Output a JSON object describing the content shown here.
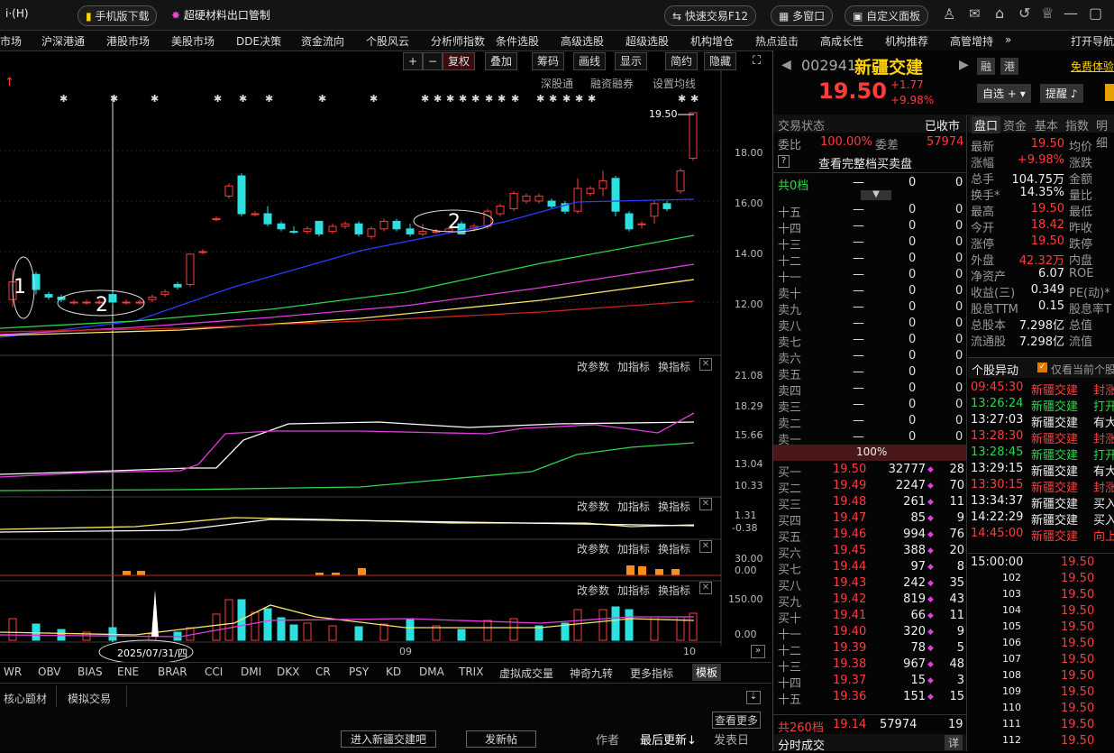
{
  "topbar": {
    "app_logo": "i·(H)",
    "mobile_btn": "手机版下载",
    "news_btn": "超硬材料出口管制",
    "quick_trade": "快速交易F12",
    "multi_window": "多窗口",
    "custom_panel": "自定义面板"
  },
  "menu": [
    "市场",
    "沪深港通",
    "港股市场",
    "美股市场",
    "DDE决策",
    "资金流向",
    "个股风云",
    "分析师指数",
    "条件选股",
    "高级选股",
    "超级选股",
    "机构增仓",
    "热点追击",
    "高成长性",
    "机构推荐",
    "高管增持",
    "»",
    "打开导航"
  ],
  "chart_toolbar": {
    "plus": "+",
    "minus": "−",
    "fuquan": "复权",
    "diejia": "叠加",
    "chouma": "筹码",
    "huaxian": "画线",
    "xianshi": "显示",
    "jianyue": "简约",
    "yincang": "隐藏",
    "shengutong": "深股通",
    "rongzi": "融资融券",
    "junxian": "设置均线"
  },
  "price_axis": [
    "18.00",
    "16.00",
    "14.00",
    "12.00"
  ],
  "last_price_label": "19.50",
  "annotations": {
    "one": "1",
    "two_a": "2",
    "two_b": "2"
  },
  "sub1": {
    "axis": [
      "21.08",
      "18.29",
      "15.66",
      "13.04",
      "10.33"
    ]
  },
  "sub2": {
    "axis": [
      "1.31",
      "-0.38"
    ]
  },
  "sub3": {
    "axis": [
      "30.00",
      "0.00"
    ]
  },
  "sub4": {
    "axis": [
      "150.00",
      "0.00"
    ]
  },
  "sub_buttons": {
    "param": "改参数",
    "add": "加指标",
    "switch": "换指标"
  },
  "x_axis": {
    "date_label": "2025/07/31/四",
    "m09": "09",
    "m10": "10"
  },
  "ind_tabs": [
    "WR",
    "OBV",
    "BIAS",
    "ENE",
    "BRAR",
    "CCI",
    "DMI",
    "DKX",
    "CR",
    "PSY",
    "KD",
    "DMA",
    "TRIX",
    "虚拟成交量",
    "神奇九转",
    "更多指标",
    "模板"
  ],
  "footer": {
    "tab1": "核心题材",
    "tab2": "模拟交易",
    "more": "查看更多",
    "enter": "进入新疆交建吧",
    "post": "发新帖",
    "author": "作者",
    "last_update": "最后更新",
    "post_date": "发表日"
  },
  "stock": {
    "code": "002941",
    "name": "新疆交建",
    "price": "19.50",
    "change": "+1.77",
    "pct": "+9.98%",
    "tag_rong": "融",
    "tag_gang": "港",
    "free_trial": "免费体验",
    "zixuan": "自选",
    "tixing": "提醒"
  },
  "orderbook": {
    "status_label": "交易状态",
    "status_value": "已收市",
    "weibi_label": "委比",
    "weibi_value": "100.00%",
    "weicha_label": "委差",
    "weicha_value": "57974",
    "full_link": "查看完整档买卖盘",
    "top_label": "共0档",
    "top_dash": "—",
    "top_v1": "0",
    "top_v2": "0",
    "asks": [
      {
        "label": "十五",
        "price": "—",
        "vol": "0",
        "cnt": "0"
      },
      {
        "label": "十四",
        "price": "—",
        "vol": "0",
        "cnt": "0"
      },
      {
        "label": "十三",
        "price": "—",
        "vol": "0",
        "cnt": "0"
      },
      {
        "label": "十二",
        "price": "—",
        "vol": "0",
        "cnt": "0"
      },
      {
        "label": "十一",
        "price": "—",
        "vol": "0",
        "cnt": "0"
      },
      {
        "label": "卖十",
        "price": "—",
        "vol": "0",
        "cnt": "0"
      },
      {
        "label": "卖九",
        "price": "—",
        "vol": "0",
        "cnt": "0"
      },
      {
        "label": "卖八",
        "price": "—",
        "vol": "0",
        "cnt": "0"
      },
      {
        "label": "卖七",
        "price": "—",
        "vol": "0",
        "cnt": "0"
      },
      {
        "label": "卖六",
        "price": "—",
        "vol": "0",
        "cnt": "0"
      },
      {
        "label": "卖五",
        "price": "—",
        "vol": "0",
        "cnt": "0"
      },
      {
        "label": "卖四",
        "price": "—",
        "vol": "0",
        "cnt": "0"
      },
      {
        "label": "卖三",
        "price": "—",
        "vol": "0",
        "cnt": "0"
      },
      {
        "label": "卖二",
        "price": "—",
        "vol": "0",
        "cnt": "0"
      },
      {
        "label": "卖一",
        "price": "—",
        "vol": "0",
        "cnt": "0"
      }
    ],
    "ratio": "100%",
    "bids": [
      {
        "label": "买一",
        "price": "19.50",
        "vol": "32777",
        "cnt": "28"
      },
      {
        "label": "买二",
        "price": "19.49",
        "vol": "2247",
        "cnt": "70"
      },
      {
        "label": "买三",
        "price": "19.48",
        "vol": "261",
        "cnt": "11"
      },
      {
        "label": "买四",
        "price": "19.47",
        "vol": "85",
        "cnt": "9"
      },
      {
        "label": "买五",
        "price": "19.46",
        "vol": "994",
        "cnt": "76"
      },
      {
        "label": "买六",
        "price": "19.45",
        "vol": "388",
        "cnt": "20"
      },
      {
        "label": "买七",
        "price": "19.44",
        "vol": "97",
        "cnt": "8"
      },
      {
        "label": "买八",
        "price": "19.43",
        "vol": "242",
        "cnt": "35"
      },
      {
        "label": "买九",
        "price": "19.42",
        "vol": "819",
        "cnt": "43"
      },
      {
        "label": "买十",
        "price": "19.41",
        "vol": "66",
        "cnt": "11"
      },
      {
        "label": "十一",
        "price": "19.40",
        "vol": "320",
        "cnt": "9"
      },
      {
        "label": "十二",
        "price": "19.39",
        "vol": "78",
        "cnt": "5"
      },
      {
        "label": "十三",
        "price": "19.38",
        "vol": "967",
        "cnt": "48"
      },
      {
        "label": "十四",
        "price": "19.37",
        "vol": "15",
        "cnt": "3"
      },
      {
        "label": "十五",
        "price": "19.36",
        "vol": "151",
        "cnt": "15"
      }
    ],
    "total_label": "共260档",
    "total_price": "19.14",
    "total_vol": "57974",
    "total_cnt": "19",
    "fenshi": "分时成交",
    "detail": "详"
  },
  "quote_tabs": [
    "盘口",
    "资金",
    "基本",
    "指数",
    "明细"
  ],
  "quote": [
    {
      "l": "最新",
      "v": "19.50",
      "l2": "均价"
    },
    {
      "l": "涨幅",
      "v": "+9.98%",
      "l2": "涨跌"
    },
    {
      "l": "总手",
      "v": "104.75万",
      "l2": "金额"
    },
    {
      "l": "换手*",
      "v": "14.35%",
      "l2": "量比"
    },
    {
      "l": "最高",
      "v": "19.50",
      "l2": "最低"
    },
    {
      "l": "今开",
      "v": "18.42",
      "l2": "昨收"
    },
    {
      "l": "涨停",
      "v": "19.50",
      "l2": "跌停"
    },
    {
      "l": "外盘",
      "v": "42.32万",
      "l2": "内盘"
    },
    {
      "l": "净资产",
      "v": "6.07",
      "l2": "ROE"
    },
    {
      "l": "收益(三)",
      "v": "0.349",
      "l2": "PE(动)*"
    },
    {
      "l": "股息TTM",
      "v": "0.15",
      "l2": "股息率T"
    },
    {
      "l": "总股本",
      "v": "7.298亿",
      "l2": "总值"
    },
    {
      "l": "流通股",
      "v": "7.298亿",
      "l2": "流值"
    }
  ],
  "events_header": {
    "title": "个股异动",
    "only_current": "仅看当前个股"
  },
  "events": [
    {
      "t": "09:45:30",
      "n": "新疆交建",
      "a": "封涨",
      "c": "red"
    },
    {
      "t": "13:26:24",
      "n": "新疆交建",
      "a": "打开",
      "c": "green"
    },
    {
      "t": "13:27:03",
      "n": "新疆交建",
      "a": "有大",
      "c": "white"
    },
    {
      "t": "13:28:30",
      "n": "新疆交建",
      "a": "封涨",
      "c": "red"
    },
    {
      "t": "13:28:45",
      "n": "新疆交建",
      "a": "打开",
      "c": "green"
    },
    {
      "t": "13:29:15",
      "n": "新疆交建",
      "a": "有大",
      "c": "white"
    },
    {
      "t": "13:30:15",
      "n": "新疆交建",
      "a": "封涨",
      "c": "red"
    },
    {
      "t": "13:34:37",
      "n": "新疆交建",
      "a": "买入",
      "c": "white"
    },
    {
      "t": "14:22:29",
      "n": "新疆交建",
      "a": "买入",
      "c": "white"
    },
    {
      "t": "14:45:00",
      "n": "新疆交建",
      "a": "向上",
      "c": "red"
    }
  ],
  "ticks": [
    {
      "t": "15:00:00",
      "p": "19.50"
    },
    {
      "t": "102",
      "p": "19.50"
    },
    {
      "t": "103",
      "p": "19.50"
    },
    {
      "t": "104",
      "p": "19.50"
    },
    {
      "t": "105",
      "p": "19.50"
    },
    {
      "t": "106",
      "p": "19.50"
    },
    {
      "t": "107",
      "p": "19.50"
    },
    {
      "t": "108",
      "p": "19.50"
    },
    {
      "t": "109",
      "p": "19.50"
    },
    {
      "t": "110",
      "p": "19.50"
    },
    {
      "t": "111",
      "p": "19.50"
    },
    {
      "t": "112",
      "p": "19.50"
    }
  ],
  "colors": {
    "up": "#ff3b3b",
    "down": "#2de0e0",
    "ma_white": "#ffffff",
    "ma_yellow": "#f5e66a",
    "ma_mag": "#e23ce0",
    "ma_green": "#3fd43f",
    "ma_red": "#d02020",
    "ma_blue": "#2b4bff"
  }
}
